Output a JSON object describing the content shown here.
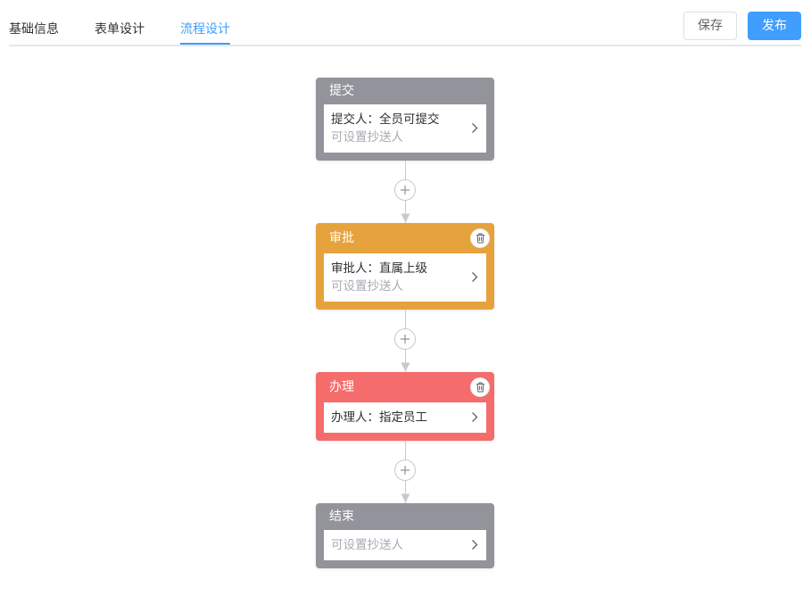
{
  "tabs": [
    {
      "label": "基础信息",
      "active": false
    },
    {
      "label": "表单设计",
      "active": false
    },
    {
      "label": "流程设计",
      "active": true
    }
  ],
  "actions": {
    "save_label": "保存",
    "publish_label": "发布"
  },
  "colors": {
    "accent": "#409eff",
    "submit_node": "#92939b",
    "approve_node": "#e6a23c",
    "handle_node": "#f56c6c",
    "end_node": "#92939b"
  },
  "flow": {
    "nodes": [
      {
        "type": "submit",
        "title": "提交",
        "line1": "提交人：全员可提交",
        "line2": "可设置抄送人",
        "deletable": false,
        "icons": [
          "chevron-right-icon"
        ]
      },
      {
        "type": "approve",
        "title": "审批",
        "line1": "审批人：直属上级",
        "line2": "可设置抄送人",
        "deletable": true,
        "icons": [
          "trash-icon",
          "chevron-right-icon"
        ]
      },
      {
        "type": "handle",
        "title": "办理",
        "line1": "办理人：指定员工",
        "deletable": true,
        "icons": [
          "trash-icon",
          "chevron-right-icon"
        ]
      },
      {
        "type": "end",
        "title": "结束",
        "line2": "可设置抄送人",
        "deletable": false,
        "icons": [
          "chevron-right-icon"
        ]
      }
    ],
    "connector_icon": "plus-icon"
  }
}
